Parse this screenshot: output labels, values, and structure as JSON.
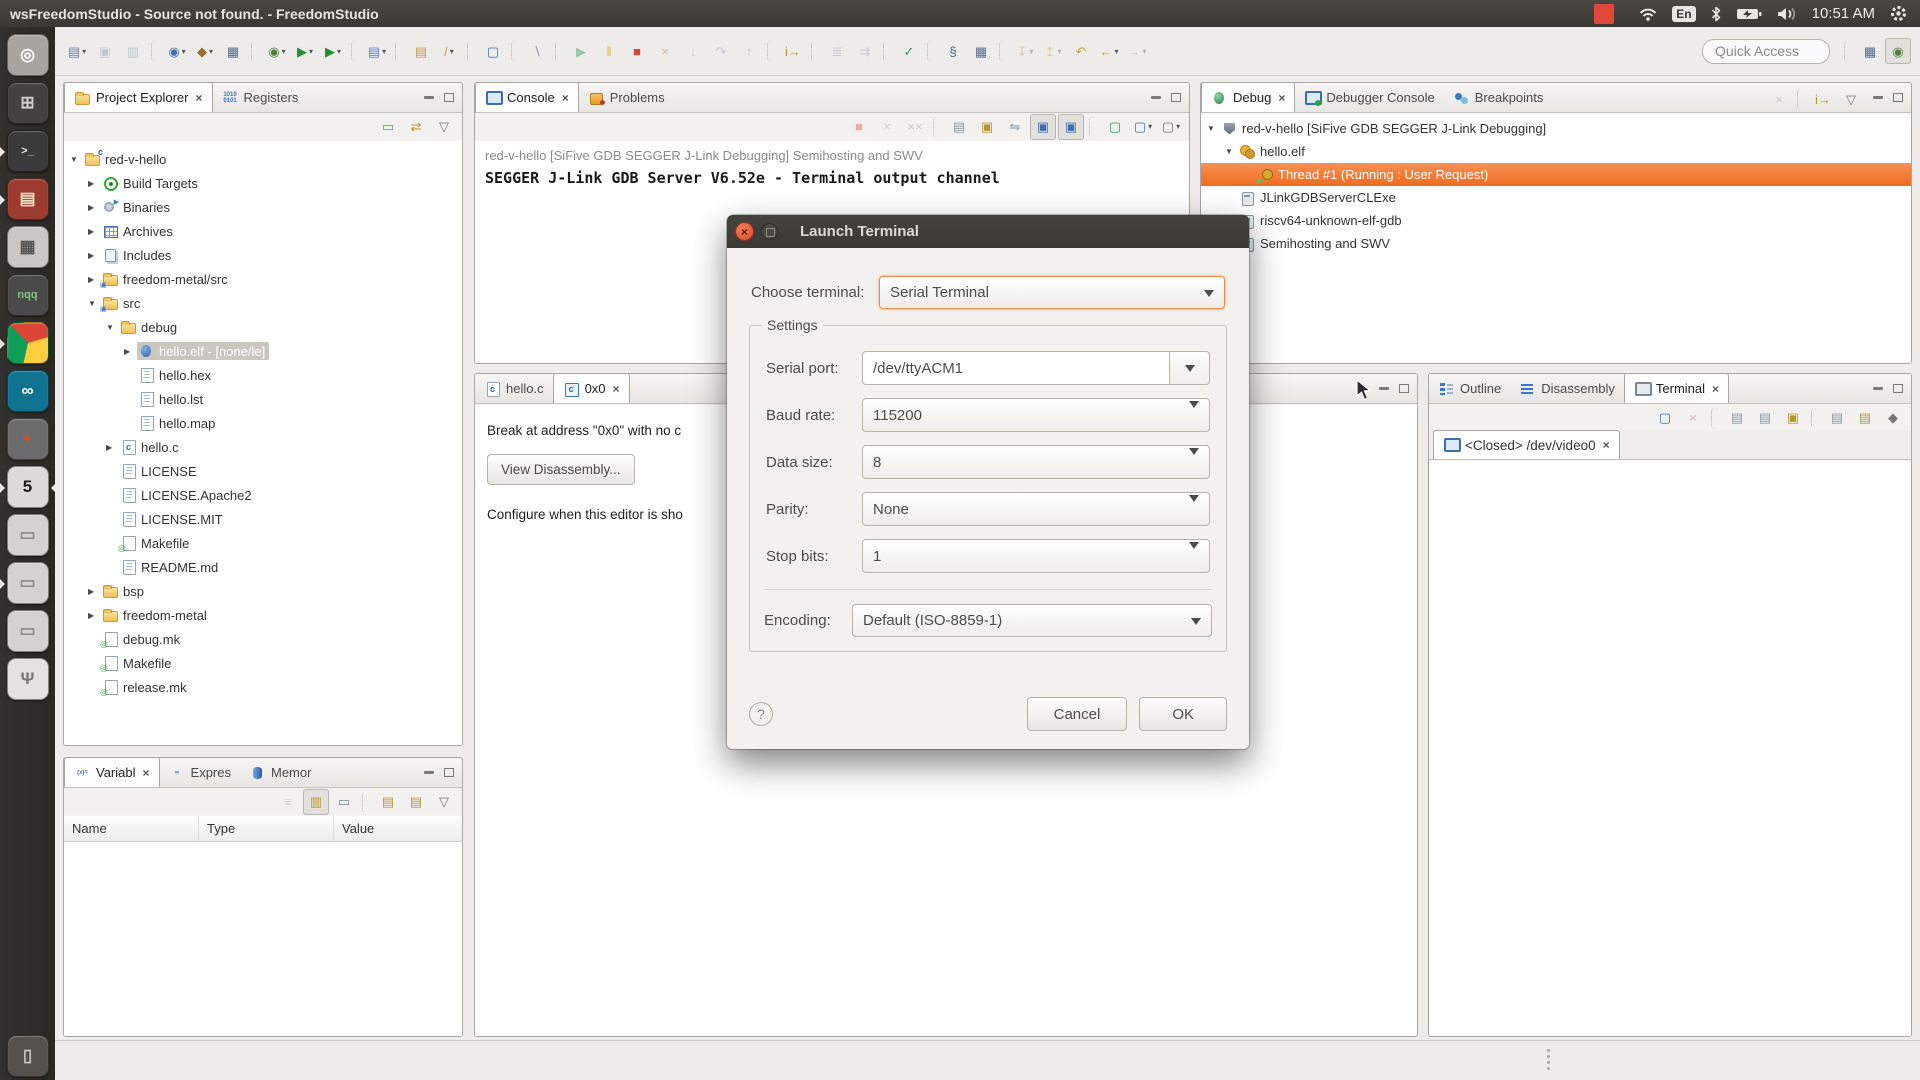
{
  "menubar": {
    "title": "wsFreedomStudio - Source not found. - FreedomStudio",
    "clock": "10:51 AM",
    "keyboard_layout": "En"
  },
  "launcher": {
    "items": [
      {
        "name": "launcher-ubuntu-dash",
        "glyph": "◎",
        "bg": "#a8a5a0",
        "fg": "#ffffff"
      },
      {
        "name": "launcher-workspace-switcher",
        "glyph": "⊞",
        "bg": "#44423e",
        "fg": "#cfcdc9"
      },
      {
        "name": "launcher-terminal",
        "glyph": ">_",
        "bg": "#3a3a3a",
        "fg": "#e8e6e3",
        "cls": "run small"
      },
      {
        "name": "launcher-archive-manager",
        "glyph": "▤",
        "bg": "#9c3c31",
        "fg": "#f0dfc0",
        "cls": "run"
      },
      {
        "name": "launcher-calculator",
        "glyph": "▦",
        "bg": "#c9c7c3",
        "fg": "#555555"
      },
      {
        "name": "launcher-notepadqq",
        "glyph": "nqq",
        "bg": "#4a4a4a",
        "fg": "#7ec87e",
        "cls": "small"
      },
      {
        "name": "launcher-chrome",
        "glyph": "",
        "bg": "#e8e6e3",
        "cls": "run chrome"
      },
      {
        "name": "launcher-arduino",
        "glyph": "∞",
        "bg": "#0f7391",
        "fg": "#ffffff"
      },
      {
        "name": "launcher-tweak-tool",
        "glyph": "+",
        "bg": "#6b6b6b",
        "fg": "#d05030"
      },
      {
        "name": "launcher-freedomstudio",
        "glyph": "5",
        "bg": "#dcdad6",
        "fg": "#1a1a1a",
        "cls": "run focus"
      },
      {
        "name": "launcher-disk-1",
        "glyph": "▭",
        "bg": "#d4d2ce",
        "fg": "#8a8a8a"
      },
      {
        "name": "launcher-disk-2",
        "glyph": "▭",
        "bg": "#d4d2ce",
        "fg": "#8a8a8a",
        "cls": "run"
      },
      {
        "name": "launcher-disk-3",
        "glyph": "▭",
        "bg": "#d4d2ce",
        "fg": "#8a8a8a"
      },
      {
        "name": "launcher-usb-drive",
        "glyph": "Ψ",
        "bg": "#e4e2de",
        "fg": "#777777"
      }
    ],
    "trash": {
      "name": "launcher-trash",
      "glyph": "▯",
      "bg": "#55524d",
      "fg": "#c9c7c3"
    }
  },
  "toolbar": {
    "quick_access": "Quick Access",
    "items": [
      {
        "name": "new-button",
        "glyph": "▤",
        "color": "#6b86ad",
        "dd": "▾"
      },
      {
        "name": "save-button",
        "glyph": "▣",
        "color": "#7d8fa5",
        "cls": "dis"
      },
      {
        "name": "save-all-button",
        "glyph": "▥",
        "color": "#7d8fa5",
        "cls": "dis"
      },
      {
        "cls": "sep",
        "inter": false
      },
      {
        "name": "upload-button",
        "glyph": "◉",
        "color": "#3f6fa8",
        "dd": "▾"
      },
      {
        "name": "build-button",
        "glyph": "◆",
        "color": "#9a6b2f",
        "dd": "▾"
      },
      {
        "name": "build-project-button",
        "glyph": "▦",
        "color": "#556b8a"
      },
      {
        "cls": "sep",
        "inter": false
      },
      {
        "name": "debug-button",
        "glyph": "◉",
        "color": "#4f7f3f",
        "dd": "▾"
      },
      {
        "name": "run-button",
        "glyph": "▶",
        "color": "#1f8f3a",
        "dd": "▾"
      },
      {
        "name": "external-tools-button",
        "glyph": "▶",
        "color": "#1f8f3a",
        "dd": "▾"
      },
      {
        "cls": "sep",
        "inter": false
      },
      {
        "name": "new-source-button",
        "glyph": "▤",
        "color": "#5b7fbf",
        "dd": "▾"
      },
      {
        "cls": "sep",
        "inter": false
      },
      {
        "name": "open-element-button",
        "glyph": "▤",
        "color": "#c9a227"
      },
      {
        "name": "search-button",
        "glyph": "/",
        "color": "#c9a227",
        "dd": "▾"
      },
      {
        "cls": "sep",
        "inter": false
      },
      {
        "name": "console-view-button",
        "glyph": "▢",
        "color": "#3f6fa8"
      },
      {
        "cls": "sep",
        "inter": false
      },
      {
        "name": "skip-breakpoints-button",
        "glyph": "∖",
        "color": "#8a97a5"
      },
      {
        "cls": "sep",
        "inter": false
      },
      {
        "name": "resume-button",
        "glyph": "▶",
        "color": "#1f8f3a",
        "cls": "dis"
      },
      {
        "name": "suspend-button",
        "glyph": "‖",
        "color": "#e0b050"
      },
      {
        "name": "terminate-button",
        "glyph": "■",
        "color": "#cc4b3c"
      },
      {
        "name": "disconnect-button",
        "glyph": "×",
        "color": "#b06a5a",
        "cls": "dis"
      },
      {
        "name": "step-into-button",
        "glyph": "↓",
        "color": "#8a97a5",
        "cls": "dis"
      },
      {
        "name": "step-over-button",
        "glyph": "↷",
        "color": "#8a97a5",
        "cls": "dis"
      },
      {
        "name": "step-return-button",
        "glyph": "↑",
        "color": "#8a97a5",
        "cls": "dis"
      },
      {
        "cls": "sep",
        "inter": false
      },
      {
        "name": "restart-button",
        "glyph": "i→",
        "color": "#b8962e"
      },
      {
        "cls": "sep",
        "inter": false
      },
      {
        "name": "instruction-stepping-button",
        "glyph": "≣",
        "color": "#8a97a5",
        "cls": "dis"
      },
      {
        "name": "autostep-button",
        "glyph": "⇉",
        "color": "#8a97a5",
        "cls": "dis"
      },
      {
        "cls": "sep",
        "inter": false
      },
      {
        "name": "mark-occurrences-button",
        "glyph": "✓",
        "color": "#2f9e44"
      },
      {
        "cls": "sep",
        "inter": false
      },
      {
        "name": "load-symbols-button",
        "glyph": "§",
        "color": "#556b8a"
      },
      {
        "name": "profile-button",
        "glyph": "▦",
        "color": "#556b8a"
      },
      {
        "cls": "sep",
        "inter": false
      },
      {
        "name": "pin-editor-button",
        "glyph": "↧",
        "color": "#c9a227",
        "cls": "dis",
        "dd": "▾"
      },
      {
        "name": "goto-annotation-button",
        "glyph": "↥",
        "color": "#c9a227",
        "cls": "dis",
        "dd": "▾"
      },
      {
        "name": "last-edit-button",
        "glyph": "↶",
        "color": "#c9a227"
      },
      {
        "name": "back-button",
        "glyph": "←",
        "color": "#c9a227",
        "dd": "▾"
      },
      {
        "name": "forward-button",
        "glyph": "→",
        "color": "#8a97a5",
        "cls": "dis",
        "dd": "▾"
      }
    ],
    "perspective": [
      {
        "name": "open-perspective-button",
        "glyph": "▦",
        "color": "#556b8a"
      },
      {
        "name": "debug-perspective-button",
        "glyph": "◉",
        "color": "#4f7f3f",
        "cls": "pressed"
      }
    ]
  },
  "project_explorer": {
    "tabs": [
      {
        "name": "tab-project-explorer",
        "label": "Project Explorer",
        "icon": "folder",
        "cls": "active",
        "close": "×"
      },
      {
        "name": "tab-registers",
        "label": "Registers",
        "icon": "txt",
        "iglyph": "1010\n0101"
      }
    ],
    "toolbar": [
      {
        "name": "collapse-all-button",
        "glyph": "▭",
        "color": "#6b86ad"
      },
      {
        "name": "link-with-editor-button",
        "glyph": "⇄",
        "color": "#b8962e"
      },
      {
        "name": "view-menu-button",
        "glyph": "▽",
        "color": "#777777"
      }
    ],
    "tree": [
      {
        "label": "red-v-hello",
        "depth": 0,
        "arrow": "▼",
        "icon": "folder-c",
        "iglyph": "c"
      },
      {
        "label": "Build Targets",
        "depth": 1,
        "arrow": "▶",
        "icon": "target"
      },
      {
        "label": "Binaries",
        "depth": 1,
        "arrow": "▶",
        "icon": "binaries"
      },
      {
        "label": "Archives",
        "depth": 1,
        "arrow": "▶",
        "icon": "archives"
      },
      {
        "label": "Includes",
        "depth": 1,
        "arrow": "▶",
        "icon": "includes"
      },
      {
        "label": "freedom-metal/src",
        "depth": 1,
        "arrow": "▶",
        "icon": "folder-link",
        "iglyph": "▣"
      },
      {
        "label": "src",
        "depth": 1,
        "arrow": "▼",
        "icon": "folder-link",
        "iglyph": "▣"
      },
      {
        "label": "debug",
        "depth": 2,
        "arrow": "▼",
        "icon": "folder"
      },
      {
        "label": "hello.elf - [none/le]",
        "depth": 3,
        "arrow": "▶",
        "icon": "bug",
        "cls": "sel"
      },
      {
        "label": "hello.hex",
        "depth": 3,
        "cls": "noarr",
        "icon": "file"
      },
      {
        "label": "hello.lst",
        "depth": 3,
        "cls": "noarr",
        "icon": "file"
      },
      {
        "label": "hello.map",
        "depth": 3,
        "cls": "noarr",
        "icon": "file"
      },
      {
        "label": "hello.c",
        "depth": 2,
        "arrow": "▶",
        "icon": "cfile",
        "iglyph": "c"
      },
      {
        "label": "LICENSE",
        "depth": 2,
        "cls": "noarr",
        "icon": "file"
      },
      {
        "label": "LICENSE.Apache2",
        "depth": 2,
        "cls": "noarr",
        "icon": "file"
      },
      {
        "label": "LICENSE.MIT",
        "depth": 2,
        "cls": "noarr",
        "icon": "file"
      },
      {
        "label": "Makefile",
        "depth": 2,
        "cls": "noarr",
        "icon": "make",
        "iglyph": "◎"
      },
      {
        "label": "README.md",
        "depth": 2,
        "cls": "noarr",
        "icon": "file"
      },
      {
        "label": "bsp",
        "depth": 1,
        "arrow": "▶",
        "icon": "folder"
      },
      {
        "label": "freedom-metal",
        "depth": 1,
        "arrow": "▶",
        "icon": "folder"
      },
      {
        "label": "debug.mk",
        "depth": 1,
        "cls": "noarr",
        "icon": "make",
        "iglyph": "◎"
      },
      {
        "label": "Makefile",
        "depth": 1,
        "cls": "noarr",
        "icon": "make",
        "iglyph": "◎"
      },
      {
        "label": "release.mk",
        "depth": 1,
        "cls": "noarr",
        "icon": "make",
        "iglyph": "◎"
      }
    ]
  },
  "variables": {
    "tabs": [
      {
        "name": "tab-variables",
        "label": "Variabl",
        "icon": "txt",
        "iglyph": "(x)=",
        "cls": "active",
        "close": "×"
      },
      {
        "name": "tab-expressions",
        "label": "Expres",
        "icon": "txt",
        "iglyph": "∞"
      },
      {
        "name": "tab-memory",
        "label": "Memor",
        "icon": "memory"
      }
    ],
    "toolbar": [
      {
        "name": "show-type-names-button",
        "glyph": "≡",
        "color": "#8a97a5",
        "cls": "dis"
      },
      {
        "name": "show-logical-structure-button",
        "glyph": "▥",
        "color": "#b8962e",
        "cls": "pressed"
      },
      {
        "name": "collapse-all-button",
        "glyph": "▭",
        "color": "#6b86ad"
      },
      {
        "cls": "sep",
        "inter": false
      },
      {
        "name": "add-watch-button",
        "glyph": "▤",
        "color": "#b8962e"
      },
      {
        "name": "export-button",
        "glyph": "▤",
        "color": "#b8962e"
      },
      {
        "name": "view-menu-button",
        "glyph": "▽",
        "color": "#777777"
      }
    ],
    "columns": [
      "Name",
      "Type",
      "Value"
    ]
  },
  "console": {
    "tabs": [
      {
        "name": "tab-console",
        "label": "Console",
        "icon": "monitor",
        "cls": "active",
        "close": "×"
      },
      {
        "name": "tab-problems",
        "label": "Problems",
        "icon": "problems"
      }
    ],
    "toolbar": [
      {
        "name": "terminate-button",
        "glyph": "■",
        "color": "#cc4b3c",
        "cls": "dis"
      },
      {
        "name": "remove-launch-button",
        "glyph": "×",
        "color": "#8a97a5",
        "cls": "dis"
      },
      {
        "name": "remove-all-launches-button",
        "glyph": "××",
        "color": "#8a97a5",
        "cls": "dis"
      },
      {
        "cls": "sep",
        "inter": false
      },
      {
        "name": "clear-console-button",
        "glyph": "▤",
        "color": "#8a97a5"
      },
      {
        "name": "scroll-lock-button",
        "glyph": "▣",
        "color": "#b8962e"
      },
      {
        "name": "word-wrap-button",
        "glyph": "⇋",
        "color": "#8a97a5"
      },
      {
        "name": "pin-console-button",
        "glyph": "▣",
        "color": "#3f6fa8",
        "cls": "pressed"
      },
      {
        "name": "show-on-output-button",
        "glyph": "▣",
        "color": "#3f6fa8",
        "cls": "pressed"
      },
      {
        "cls": "sep",
        "inter": false
      },
      {
        "name": "display-selected-console-button",
        "glyph": "▢",
        "color": "#2f9e44"
      },
      {
        "name": "open-console-button",
        "glyph": "▢",
        "color": "#3f6fa8",
        "dd": "▾"
      },
      {
        "name": "new-console-view-button",
        "glyph": "▢",
        "color": "#777777",
        "dd": "▾"
      }
    ],
    "header": "red-v-hello [SiFive GDB SEGGER J-Link Debugging] Semihosting and SWV",
    "output": "SEGGER J-Link GDB Server V6.52e - Terminal output channel"
  },
  "editor": {
    "tabs": [
      {
        "name": "tab-hello-c",
        "label": "hello.c",
        "icon": "cfile",
        "iglyph": "c"
      },
      {
        "name": "tab-0x0",
        "label": "0x0",
        "icon": "cfile2",
        "iglyph": "c",
        "cls": "active",
        "close": "×"
      }
    ],
    "message": "Break at address \"0x0\" with no c",
    "view_disassembly_label": "View Disassembly...",
    "note": "Configure when this editor is sho"
  },
  "debug": {
    "tabs": [
      {
        "name": "tab-debug",
        "label": "Debug",
        "icon": "debugtab",
        "cls": "active",
        "close": "×"
      },
      {
        "name": "tab-debugger-console",
        "label": "Debugger Console",
        "icon": "dbgconsole"
      },
      {
        "name": "tab-breakpoints",
        "label": "Breakpoints",
        "icon": "breakpoints"
      }
    ],
    "toolbar": [
      {
        "name": "remove-all-terminated-button",
        "glyph": "×",
        "color": "#8a97a5",
        "cls": "dis"
      },
      {
        "cls": "sep",
        "inter": false
      },
      {
        "name": "restart-button",
        "glyph": "i→",
        "color": "#b8962e"
      },
      {
        "name": "view-menu-button",
        "glyph": "▽",
        "color": "#777777"
      }
    ],
    "tree": [
      {
        "label": "red-v-hello [SiFive GDB SEGGER J-Link Debugging]",
        "depth": 0,
        "arrow": "▼",
        "icon": "shield"
      },
      {
        "label": "hello.elf",
        "depth": 1,
        "arrow": "▼",
        "icon": "gears"
      },
      {
        "label": "Thread #1 (Running : User Request)",
        "depth": 2,
        "cls": "selfull noarr",
        "icon": "thread"
      },
      {
        "label": "JLinkGDBServerCLExe",
        "depth": 1,
        "cls": "noarr",
        "icon": "process"
      },
      {
        "label": "riscv64-unknown-elf-gdb",
        "depth": 1,
        "cls": "noarr",
        "icon": "process"
      },
      {
        "label": "Semihosting and SWV",
        "depth": 1,
        "cls": "noarr",
        "icon": "process"
      }
    ]
  },
  "right_panel": {
    "tabs": [
      {
        "name": "tab-outline",
        "label": "Outline",
        "icon": "outline"
      },
      {
        "name": "tab-disassembly",
        "label": "Disassembly",
        "icon": "disasm"
      },
      {
        "name": "tab-terminal",
        "label": "Terminal",
        "icon": "monitor-g",
        "cls": "active",
        "close": "×"
      }
    ],
    "toolbar": [
      {
        "name": "open-terminal-button",
        "glyph": "▢",
        "color": "#3f6fa8"
      },
      {
        "name": "disconnect-terminal-button",
        "glyph": "×",
        "color": "#b06a5a",
        "cls": "dis"
      },
      {
        "cls": "sep",
        "inter": false
      },
      {
        "name": "scroll-lock-button",
        "glyph": "▤",
        "color": "#8a97a5"
      },
      {
        "name": "clear-terminal-button",
        "glyph": "▤",
        "color": "#8a97a5"
      },
      {
        "name": "lock-button",
        "glyph": "▣",
        "color": "#b8962e"
      },
      {
        "cls": "sep",
        "inter": false
      },
      {
        "name": "copy-button",
        "glyph": "▤",
        "color": "#8a97a5"
      },
      {
        "name": "paste-button",
        "glyph": "▤",
        "color": "#b8962e"
      },
      {
        "name": "terminal-settings-button",
        "glyph": "◆",
        "color": "#777777"
      }
    ],
    "session_tab": {
      "label": "<Closed> /dev/video0",
      "close": "×"
    }
  },
  "dialog": {
    "title": "Launch Terminal",
    "choose_label": "Choose terminal:",
    "choose_value": "Serial Terminal",
    "settings_label": "Settings",
    "fields": [
      {
        "label": "Serial port:",
        "value": "/dev/ttyACM1",
        "cls": "editable",
        "name": "serial-port-combo"
      },
      {
        "label": "Baud rate:",
        "value": "115200",
        "name": "baud-rate-combo"
      },
      {
        "label": "Data size:",
        "value": "8",
        "name": "data-size-combo"
      },
      {
        "label": "Parity:",
        "value": "None",
        "name": "parity-combo"
      },
      {
        "label": "Stop bits:",
        "value": "1",
        "name": "stop-bits-combo"
      }
    ],
    "encoding_label": "Encoding:",
    "encoding_value": "Default (ISO-8859-1)",
    "help_label": "?",
    "cancel_label": "Cancel",
    "ok_label": "OK"
  }
}
